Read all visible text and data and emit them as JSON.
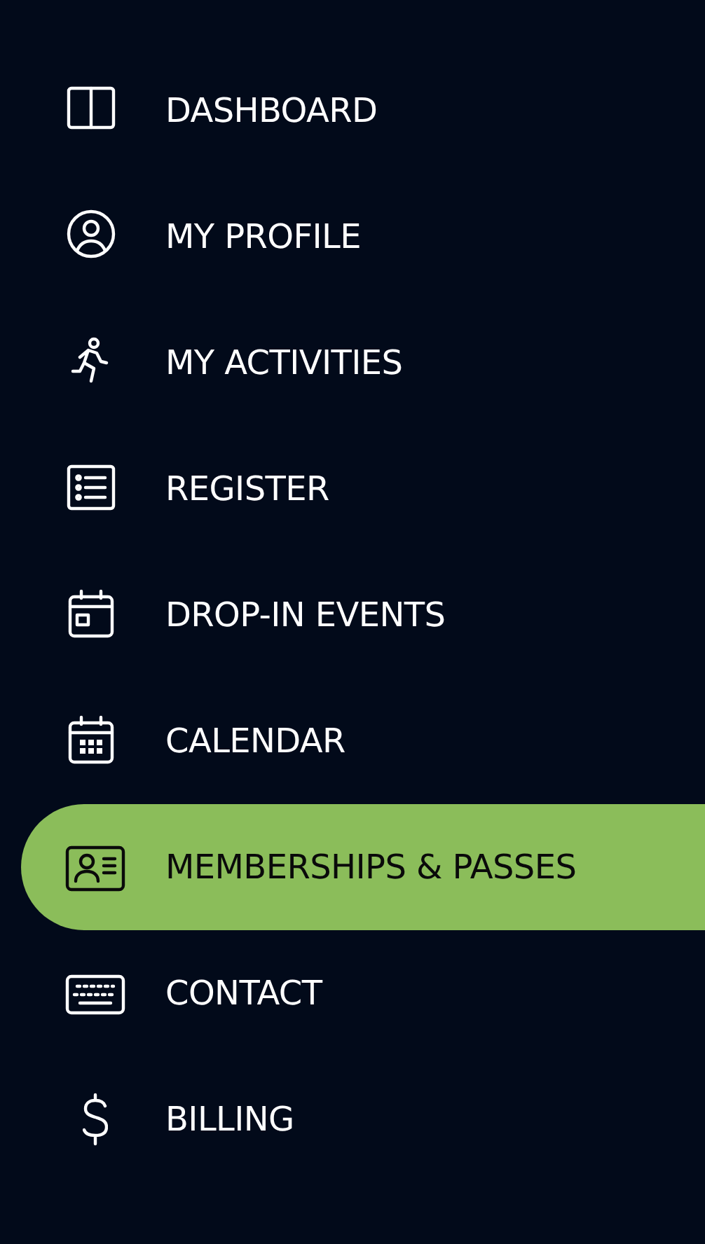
{
  "sidebar": {
    "items": [
      {
        "label": "DASHBOARD",
        "selected": false
      },
      {
        "label": "MY PROFILE",
        "selected": false
      },
      {
        "label": "MY ACTIVITIES",
        "selected": false
      },
      {
        "label": "REGISTER",
        "selected": false
      },
      {
        "label": "DROP-IN EVENTS",
        "selected": false
      },
      {
        "label": "CALENDAR",
        "selected": false
      },
      {
        "label": "MEMBERSHIPS & PASSES",
        "selected": true
      },
      {
        "label": "CONTACT",
        "selected": false
      },
      {
        "label": "BILLING",
        "selected": false
      }
    ]
  }
}
